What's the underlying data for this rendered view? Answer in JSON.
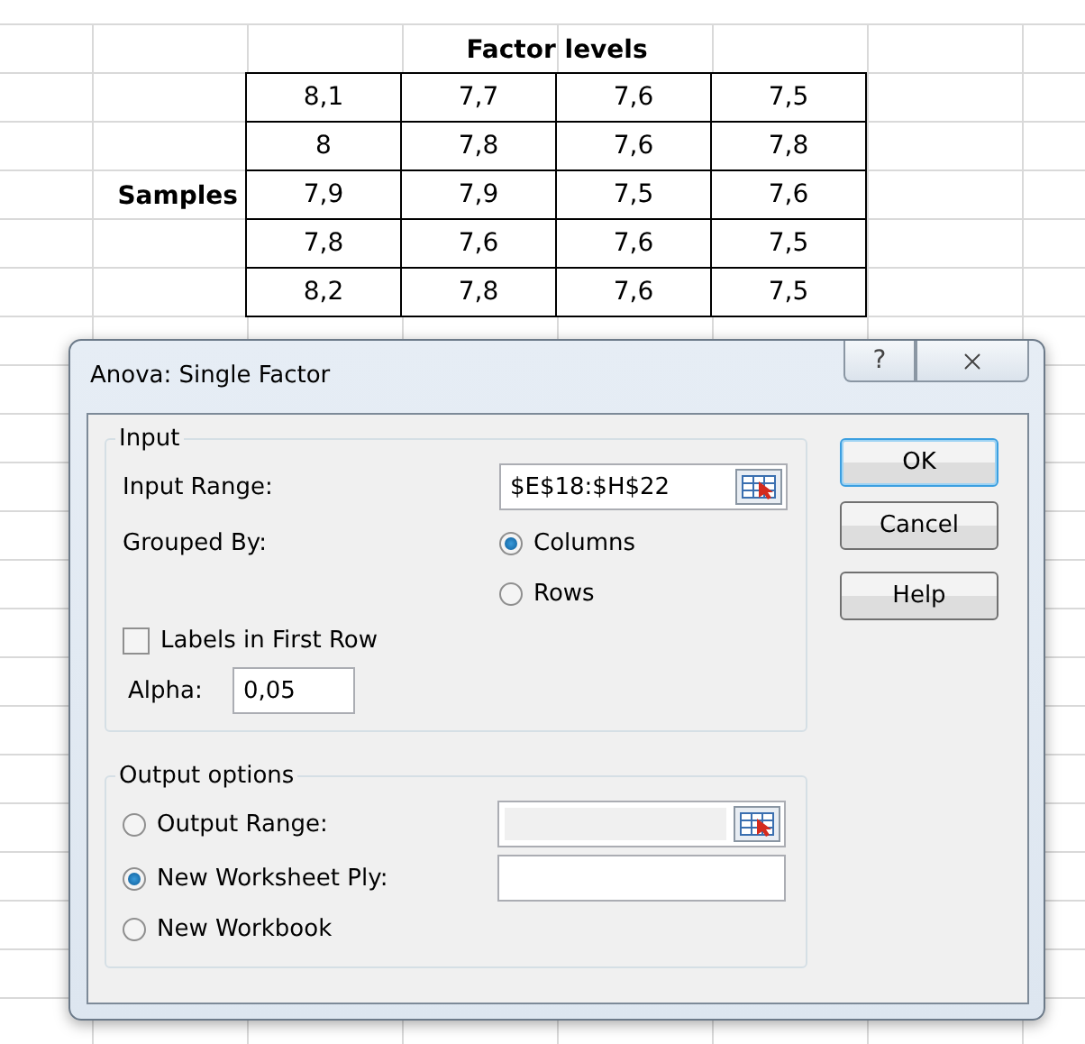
{
  "sheet": {
    "header": "Factor levels",
    "row_label": "Samples",
    "rows": [
      [
        "8,1",
        "7,7",
        "7,6",
        "7,5"
      ],
      [
        "8",
        "7,8",
        "7,6",
        "7,8"
      ],
      [
        "7,9",
        "7,9",
        "7,5",
        "7,6"
      ],
      [
        "7,8",
        "7,6",
        "7,6",
        "7,5"
      ],
      [
        "8,2",
        "7,8",
        "7,6",
        "7,5"
      ]
    ]
  },
  "dialog": {
    "title": "Anova: Single Factor",
    "help_glyph": "?",
    "input": {
      "legend": "Input",
      "input_range": {
        "label": "Input Range:",
        "value": "$E$18:$H$22"
      },
      "grouped_by": {
        "label": "Grouped By:",
        "options": [
          {
            "label": "Columns",
            "selected": true
          },
          {
            "label": "Rows",
            "selected": false
          }
        ]
      },
      "labels_in_first_row": {
        "label": "Labels in First Row",
        "checked": false
      },
      "alpha": {
        "label": "Alpha:",
        "value": "0,05"
      }
    },
    "output": {
      "legend": "Output options",
      "options": [
        {
          "label": "Output Range:",
          "selected": false,
          "kind": "range",
          "disabled": true
        },
        {
          "label": "New Worksheet Ply:",
          "selected": true,
          "kind": "text",
          "disabled": false
        },
        {
          "label": "New Workbook",
          "selected": false,
          "kind": "none"
        }
      ]
    },
    "buttons": [
      {
        "label": "OK",
        "default": true
      },
      {
        "label": "Cancel",
        "default": false
      },
      {
        "label": "Help",
        "default": false
      }
    ]
  }
}
